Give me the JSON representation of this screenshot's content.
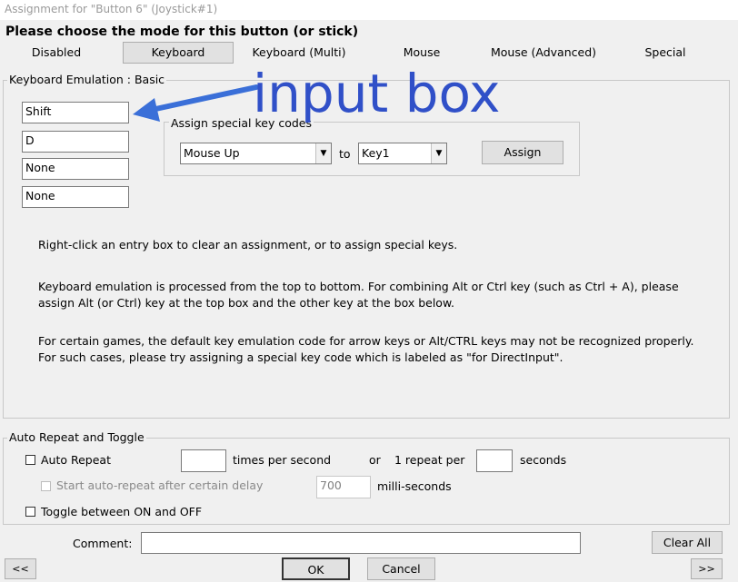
{
  "window": {
    "title": "Assignment for \"Button 6\" (Joystick#1)"
  },
  "heading": "Please choose the mode for this button (or stick)",
  "tabs": [
    {
      "label": "Disabled"
    },
    {
      "label": "Keyboard"
    },
    {
      "label": "Keyboard (Multi)"
    },
    {
      "label": "Mouse"
    },
    {
      "label": "Mouse (Advanced)"
    },
    {
      "label": "Special"
    }
  ],
  "active_tab": "Keyboard",
  "keyboard_group": {
    "legend": "Keyboard Emulation : Basic",
    "key_boxes": [
      "Shift",
      "D",
      "None",
      "None"
    ],
    "special": {
      "legend": "Assign special key codes",
      "from_value": "Mouse Up",
      "to_label": "to",
      "to_value": "Key1",
      "assign_label": "Assign"
    },
    "info": [
      "Right-click an entry box to clear an assignment, or to assign special keys.",
      "Keyboard emulation is processed from the top to bottom.  For combining Alt or Ctrl key (such as Ctrl + A), please",
      "assign Alt (or Ctrl) key at the top box and the other key at the box below.",
      "For certain games, the default key emulation code for arrow keys or Alt/CTRL keys may not be recognized properly.",
      "For such cases, please try assigning a special key code which is labeled as \"for DirectInput\"."
    ]
  },
  "annotation": {
    "text": "input box",
    "color": "#3050c8"
  },
  "repeat_group": {
    "legend": "Auto Repeat and Toggle",
    "auto_repeat_label": "Auto Repeat",
    "times_value": "",
    "times_label": "times per second",
    "or_label": "or",
    "one_repeat_label": "1 repeat per",
    "seconds_value": "",
    "seconds_label": "seconds",
    "delay_label": "Start auto-repeat after certain delay",
    "delay_value": "700",
    "ms_label": "milli-seconds",
    "toggle_label": "Toggle between ON and OFF"
  },
  "footer": {
    "comment_label": "Comment:",
    "comment_value": "",
    "clear_all_label": "Clear All",
    "prev_label": "<<",
    "ok_label": "OK",
    "cancel_label": "Cancel",
    "next_label": ">>"
  }
}
